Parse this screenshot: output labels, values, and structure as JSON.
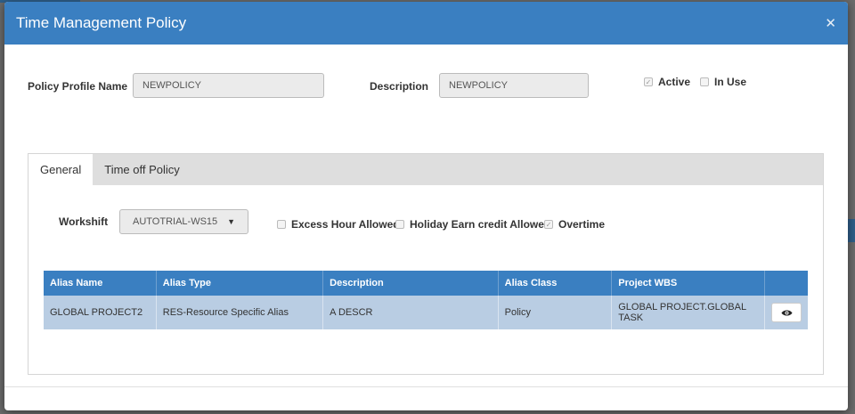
{
  "modal": {
    "title": "Time Management Policy"
  },
  "form": {
    "profile_label": "Policy Profile Name",
    "profile_value": "NEWPOLICY",
    "description_label": "Description",
    "description_value": "NEWPOLICY",
    "active_label": "Active",
    "active_checked": true,
    "inuse_label": "In Use",
    "inuse_checked": false
  },
  "tabs": [
    {
      "label": "General",
      "active": true
    },
    {
      "label": "Time off Policy",
      "active": false
    }
  ],
  "general": {
    "workshift_label": "Workshift",
    "workshift_value": "AUTOTRIAL-WS15",
    "excess_label": "Excess Hour Allowed",
    "excess_checked": false,
    "holiday_label": "Holiday Earn credit Allowed",
    "holiday_checked": false,
    "overtime_label": "Overtime",
    "overtime_checked": true
  },
  "table": {
    "headers": [
      "Alias Name",
      "Alias Type",
      "Description",
      "Alias Class",
      "Project WBS",
      ""
    ],
    "rows": [
      [
        "GLOBAL PROJECT2",
        "RES-Resource Specific Alias",
        "A DESCR",
        "Policy",
        "GLOBAL PROJECT.GLOBAL TASK"
      ]
    ]
  }
}
